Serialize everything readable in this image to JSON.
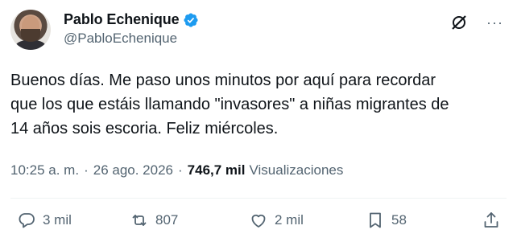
{
  "author": {
    "display_name": "Pablo Echenique",
    "handle": "@PabloEchenique",
    "verified": true,
    "verified_color": "#1d9bf0"
  },
  "header": {
    "grok_icon": "grok-slash-icon",
    "more_label": "···"
  },
  "tweet": {
    "text": "Buenos días. Me paso unos minutos por aquí para recordar\nque los que estáis llamando \"invasores\" a niñas migrantes de\n14 años sois escoria. Feliz miércoles."
  },
  "meta": {
    "time": "10:25 a. m.",
    "separator": "·",
    "date": "26 ago. 2026",
    "views_count": "746,7 mil",
    "views_label": "Visualizaciones"
  },
  "actions": {
    "replies": "3 mil",
    "retweets": "807",
    "likes": "2 mil",
    "bookmarks": "58"
  },
  "colors": {
    "text": "#0f1419",
    "muted": "#536471",
    "divider": "#eff3f4"
  }
}
